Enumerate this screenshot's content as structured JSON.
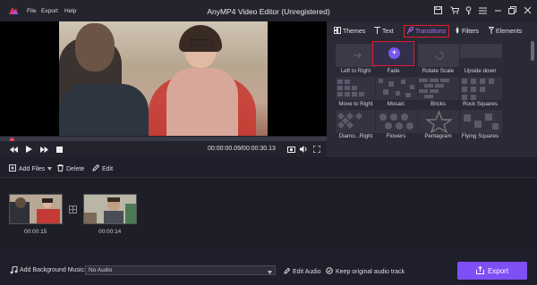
{
  "window": {
    "title": "AnyMP4 Video Editor (Unregistered)",
    "menu": [
      "File",
      "Export",
      "Help"
    ]
  },
  "player": {
    "timecode": "00:00:00.09/00:00:30.13",
    "progress": 0.02
  },
  "tabs": [
    {
      "label": "Themes",
      "icon": "themes-icon"
    },
    {
      "label": "Text",
      "icon": "text-icon"
    },
    {
      "label": "Transitions",
      "icon": "transitions-icon",
      "active": true
    },
    {
      "label": "Filters",
      "icon": "filters-icon"
    },
    {
      "label": "Elements",
      "icon": "elements-icon"
    }
  ],
  "transitions": [
    "Left to Right",
    "Fade",
    "Rotate Scale",
    "Upside down",
    "Move to Right",
    "Mosaic",
    "Bricks",
    "Rock Squares",
    "Diamo...Right",
    "Flowers",
    "Pentagram",
    "Flying Squares"
  ],
  "toolbar": {
    "add_files": "Add Files",
    "delete": "Delete",
    "edit": "Edit"
  },
  "clips": [
    {
      "duration": "00:00:15"
    },
    {
      "duration": "00:00:14"
    }
  ],
  "bottom": {
    "add_music_label": "Add Background Music:",
    "audio_value": "No Audio",
    "edit_audio": "Edit Audio",
    "keep_audio": "Keep original audio track",
    "export": "Export"
  },
  "colors": {
    "accent": "#7e4ff5",
    "highlight_border": "#e01c2c",
    "active_tab_text": "#b46cff"
  }
}
